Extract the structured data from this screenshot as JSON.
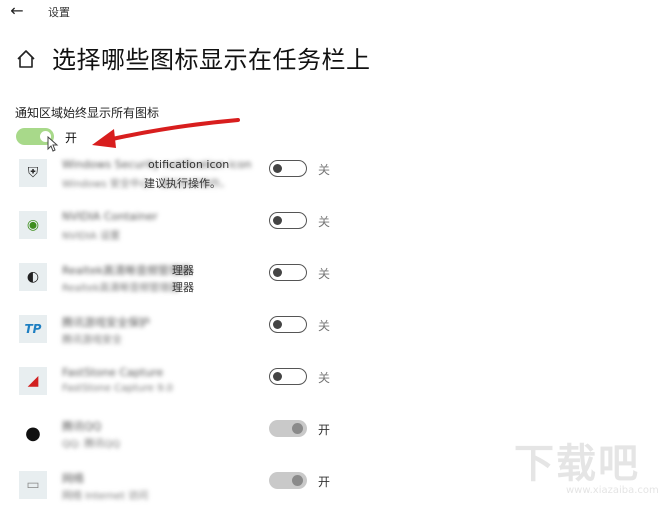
{
  "window": {
    "back_glyph": "←",
    "title": "设置"
  },
  "page": {
    "title": "选择哪些图标显示在任务栏上"
  },
  "always_show": {
    "label": "通知区域始终显示所有图标",
    "state": "开",
    "on": true
  },
  "apps": [
    {
      "name": "Windows Security notification icon",
      "name_tail": "otification icon",
      "sub": "Windows 安全中心。建议执行操作。",
      "sub_tail": "建议执行操作。",
      "icon": "shield-icon",
      "icon_glyph": "⛨",
      "icon_color": "#2b2b2b",
      "state": "关",
      "toggle": "off"
    },
    {
      "name": "NVIDIA Container",
      "name_tail": "",
      "sub": "NVIDIA 设置",
      "sub_tail": "",
      "icon": "nvidia-icon",
      "icon_glyph": "◉",
      "icon_color": "#3e8e1e",
      "state": "关",
      "toggle": "off"
    },
    {
      "name": "Realtek高清晰音频管理器",
      "name_tail": "理器",
      "sub": "Realtek高清晰音频管理器",
      "sub_tail": "理器",
      "icon": "speaker-icon",
      "icon_glyph": "◐",
      "icon_color": "#222222",
      "state": "关",
      "toggle": "off"
    },
    {
      "name": "腾讯游戏安全保护",
      "name_tail": "",
      "sub": "腾讯游戏安全",
      "sub_tail": "",
      "icon": "tp-icon",
      "icon_glyph": "TP",
      "icon_color": "#1e7fc2",
      "state": "关",
      "toggle": "off"
    },
    {
      "name": "FastStone Capture",
      "name_tail": "",
      "sub": "FastStone Capture 9.0",
      "sub_tail": "",
      "icon": "faststone-icon",
      "icon_glyph": "◢",
      "icon_color": "#d12020",
      "state": "关",
      "toggle": "off"
    },
    {
      "name": "腾讯QQ",
      "name_tail": "",
      "sub": "QQ: 腾讯QQ",
      "sub_tail": "",
      "icon": "qq-penguin-icon",
      "icon_glyph": "●",
      "icon_color": "#111111",
      "state": "开",
      "toggle": "on-disabled"
    },
    {
      "name": "网络",
      "name_tail": "",
      "sub": "网络 Internet 访问",
      "sub_tail": "",
      "icon": "network-icon",
      "icon_glyph": "▭",
      "icon_color": "#888888",
      "state": "开",
      "toggle": "on-disabled"
    }
  ],
  "watermark": {
    "text": "下载吧",
    "url": "www.xiazaiba.com"
  },
  "colors": {
    "toggle_on_light": "#a8d98a",
    "arrow_red": "#d81e1e"
  }
}
